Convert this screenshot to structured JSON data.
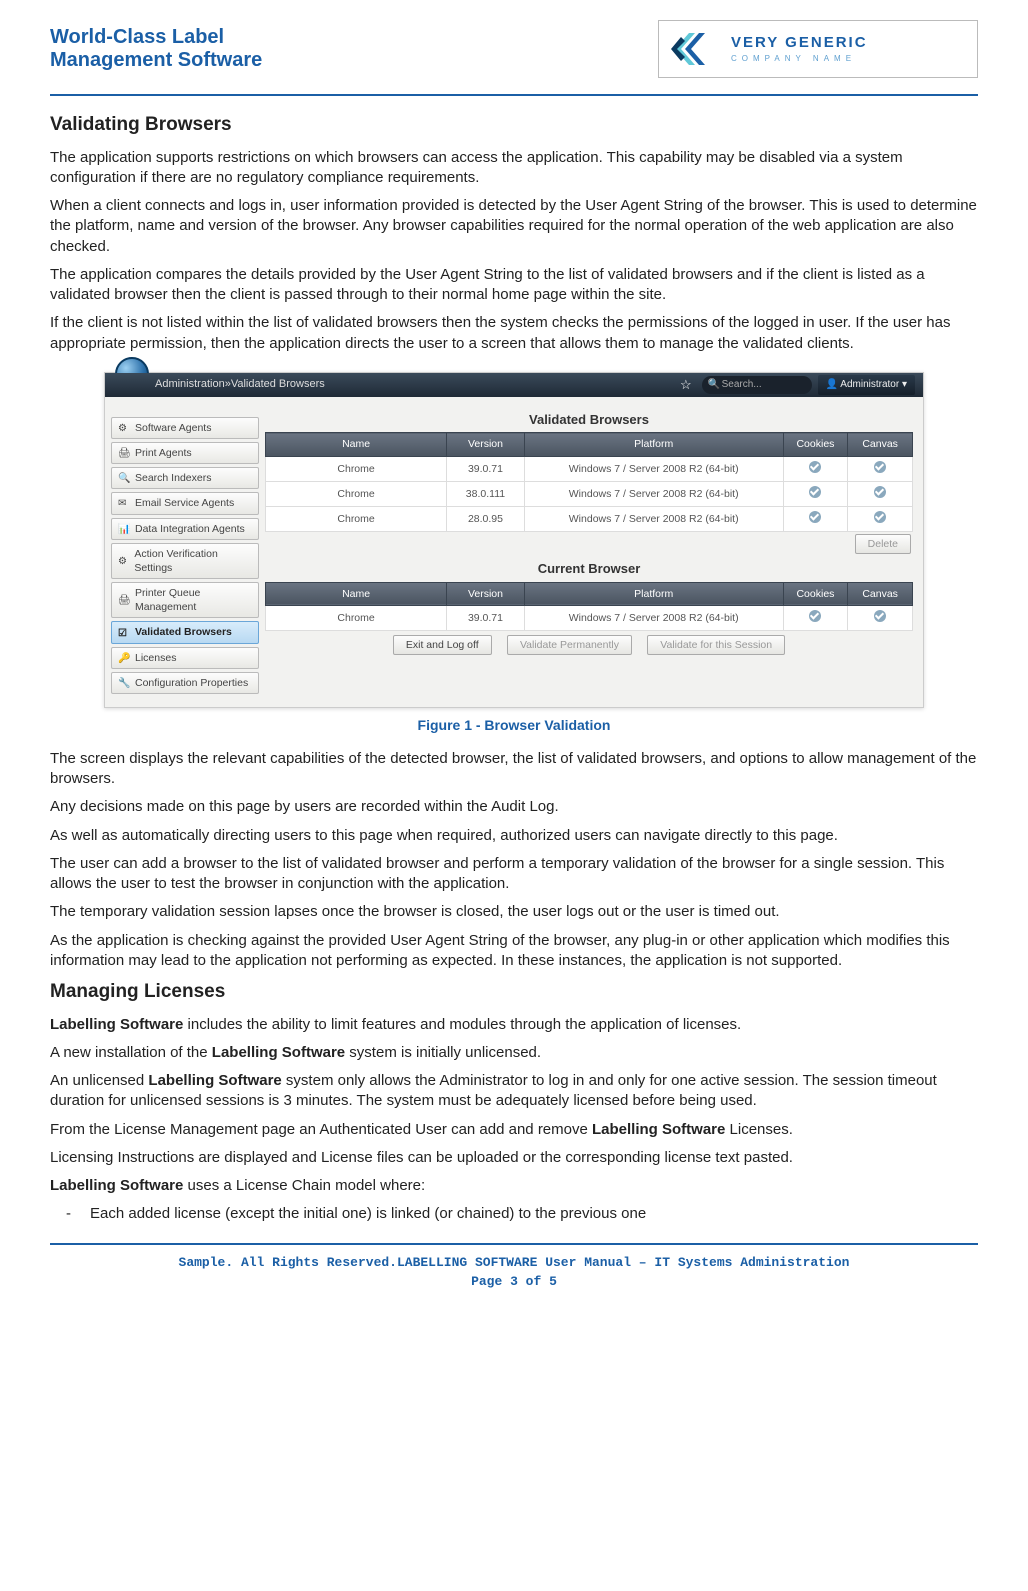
{
  "header": {
    "brand_line1": "World-Class Label",
    "brand_line2": "Management Software",
    "logo_main": "VERY GENERIC",
    "logo_sub": "COMPANY NAME"
  },
  "section1": {
    "heading": "Validating Browsers",
    "p1": "The application supports restrictions on which browsers can access the application. This capability may be disabled via a system configuration if there are no regulatory compliance requirements.",
    "p2": "When a client connects and logs in, user information provided is detected by the User Agent String of the browser. This is used to determine the platform, name and version of the browser. Any browser capabilities required for the normal operation of the web application are also checked.",
    "p3": "The application compares the details provided by the User Agent String to the list of validated browsers and if the client is listed as a validated browser then the client is passed through to their normal home page within the site.",
    "p4": "If the client is not listed within the list of validated browsers then the system checks the permissions of the logged in user. If the user has appropriate permission, then the application directs the user to a screen that allows them to manage the validated clients."
  },
  "screenshot": {
    "breadcrumb_admin": "Administration",
    "breadcrumb_sep": " » ",
    "breadcrumb_page": "Validated Browsers",
    "search_placeholder": "Search...",
    "admin_button": "Administrator ▾",
    "nav": [
      "Software Agents",
      "Print Agents",
      "Search Indexers",
      "Email Service Agents",
      "Data Integration Agents",
      "Action Verification Settings",
      "Printer Queue Management",
      "Validated Browsers",
      "Licenses",
      "Configuration Properties"
    ],
    "nav_active_index": 7,
    "validated_title": "Validated Browsers",
    "current_title": "Current Browser",
    "columns": [
      "Name",
      "Version",
      "Platform",
      "Cookies",
      "Canvas"
    ],
    "validated_rows": [
      {
        "name": "Chrome",
        "version": "39.0.71",
        "platform": "Windows 7 / Server 2008 R2 (64-bit)"
      },
      {
        "name": "Chrome",
        "version": "38.0.111",
        "platform": "Windows 7 / Server 2008 R2 (64-bit)"
      },
      {
        "name": "Chrome",
        "version": "28.0.95",
        "platform": "Windows 7 / Server 2008 R2 (64-bit)"
      }
    ],
    "current_rows": [
      {
        "name": "Chrome",
        "version": "39.0.71",
        "platform": "Windows 7 / Server 2008 R2 (64-bit)"
      }
    ],
    "delete_btn": "Delete",
    "exit_btn": "Exit and Log off",
    "validate_perm_btn": "Validate Permanently",
    "validate_sess_btn": "Validate for this Session"
  },
  "figure_caption": "Figure 1 - Browser Validation",
  "section1b": {
    "p1": "The screen displays the relevant capabilities of the detected browser, the list of validated browsers, and options to allow management of the browsers.",
    "p2": "Any decisions made on this page by users are recorded within the Audit Log.",
    "p3": "As well as automatically directing users to this page when required, authorized users can navigate directly to this page.",
    "p4": "The user can add a browser to the list of validated browser and perform a temporary validation of the browser for a single session. This allows the user to test the browser in conjunction with the application.",
    "p5": "The temporary validation session lapses once the browser is closed, the user logs out or the user is timed out.",
    "p6": "As the application is checking against the provided User Agent String of the browser, any plug-in or other application which modifies this information may lead to the application not performing as expected. In these instances, the application is not supported."
  },
  "section2": {
    "heading": "Managing Licenses",
    "p1a": "Labelling Software",
    "p1b": " includes the ability to limit features and modules through the application of licenses.",
    "p2a": "A new installation of the ",
    "p2b": "Labelling Software",
    "p2c": " system is initially unlicensed.",
    "p3a": "An unlicensed ",
    "p3b": "Labelling Software",
    "p3c": " system only allows the Administrator to log in and only for one active session. The session timeout duration for unlicensed sessions is 3 minutes. The system must be adequately licensed before being used.",
    "p4a": "From the License Management page an Authenticated User can add and remove ",
    "p4b": "Labelling Software",
    "p4c": " Licenses.",
    "p5": "Licensing Instructions are displayed and License files can be uploaded or the corresponding license text pasted.",
    "p6a": "Labelling Software",
    "p6b": " uses a License Chain model where:",
    "bullet1": "Each added license (except the initial one) is linked (or chained) to the previous one"
  },
  "footer": {
    "line1": "Sample. All Rights Reserved.LABELLING SOFTWARE User Manual – IT Systems Administration",
    "line2": "Page 3 of 5"
  }
}
